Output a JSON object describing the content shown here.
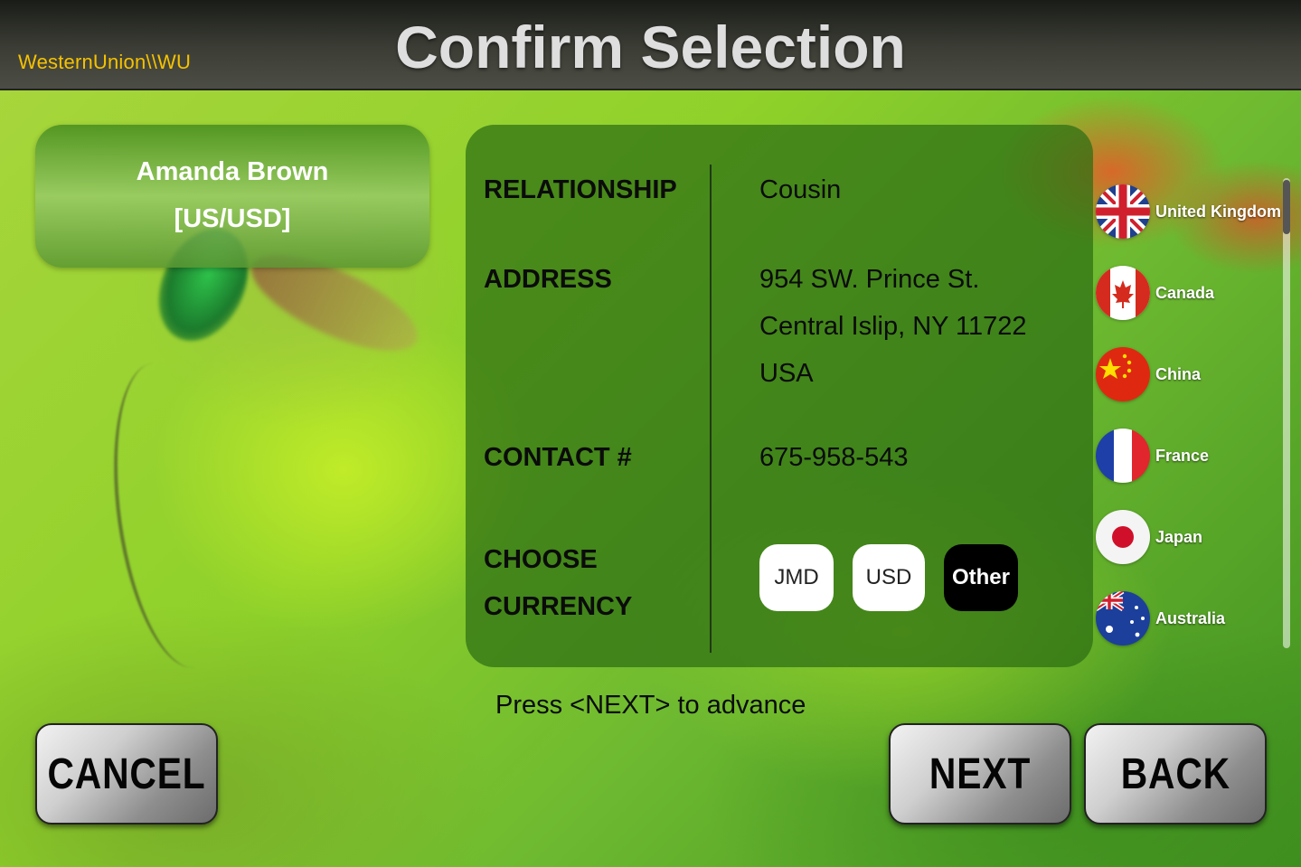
{
  "header": {
    "logo": "WesternUnion\\\\WU",
    "title": "Confirm Selection"
  },
  "recipient": {
    "name": "Amanda Brown",
    "currency": "[US/USD]"
  },
  "details": {
    "relationship_label": "RELATIONSHIP",
    "relationship_value": "Cousin",
    "address_label": "ADDRESS",
    "address_line1": "954 SW. Prince St.",
    "address_line2": "Central Islip, NY 11722",
    "address_line3": "USA",
    "contact_label": "CONTACT #",
    "contact_value": "675-958-543",
    "currency_label_line1": "CHOOSE",
    "currency_label_line2": "CURRENCY",
    "currency_options": [
      "JMD",
      "USD",
      "Other"
    ],
    "selected_currency": "Other"
  },
  "countries": [
    {
      "name": "United Kingdom",
      "flag": "uk-flag-icon"
    },
    {
      "name": "Canada",
      "flag": "canada-flag-icon"
    },
    {
      "name": "China",
      "flag": "china-flag-icon"
    },
    {
      "name": "France",
      "flag": "france-flag-icon"
    },
    {
      "name": "Japan",
      "flag": "japan-flag-icon"
    },
    {
      "name": "Australia",
      "flag": "australia-flag-icon"
    }
  ],
  "instruction": "Press <NEXT> to advance",
  "buttons": {
    "cancel": "CANCEL",
    "next": "NEXT",
    "back": "BACK"
  },
  "colors": {
    "logo": "#f6c200",
    "selected_currency_bg": "#000000"
  }
}
